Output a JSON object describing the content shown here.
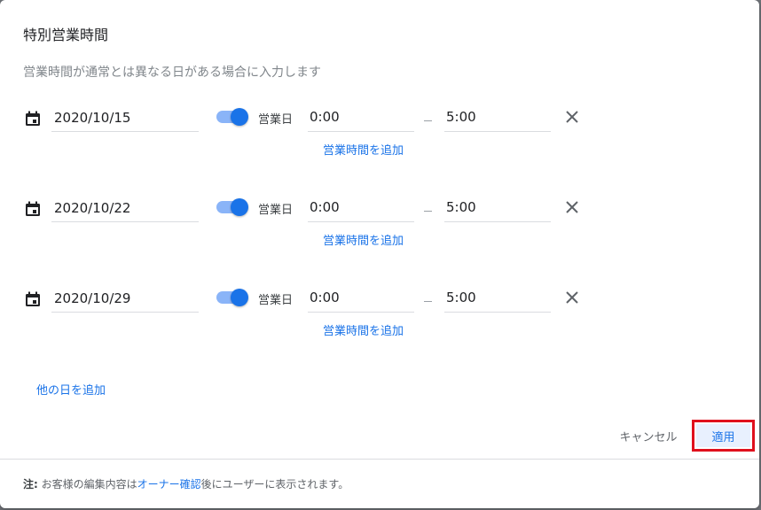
{
  "dialog": {
    "title": "特別営業時間",
    "subtitle": "営業時間が通常とは異なる日がある場合に入力します"
  },
  "rows": [
    {
      "date": "2020/10/15",
      "toggle_label": "営業日",
      "open": "0:00",
      "close": "5:00",
      "add_hours": "営業時間を追加",
      "is_open": true
    },
    {
      "date": "2020/10/22",
      "toggle_label": "営業日",
      "open": "0:00",
      "close": "5:00",
      "add_hours": "営業時間を追加",
      "is_open": true
    },
    {
      "date": "2020/10/29",
      "toggle_label": "営業日",
      "open": "0:00",
      "close": "5:00",
      "add_hours": "営業時間を追加",
      "is_open": true
    }
  ],
  "add_day_label": "他の日を追加",
  "buttons": {
    "cancel": "キャンセル",
    "apply": "適用"
  },
  "footer": {
    "note_label": "注:",
    "text_before": " お客様の編集内容は",
    "link": "オーナー確認",
    "text_after": "後にユーザーに表示されます。"
  },
  "icons": {
    "calendar": "calendar-icon",
    "close": "close-icon"
  },
  "colors": {
    "accent": "#1a73e8",
    "highlight": "#e0101d"
  }
}
